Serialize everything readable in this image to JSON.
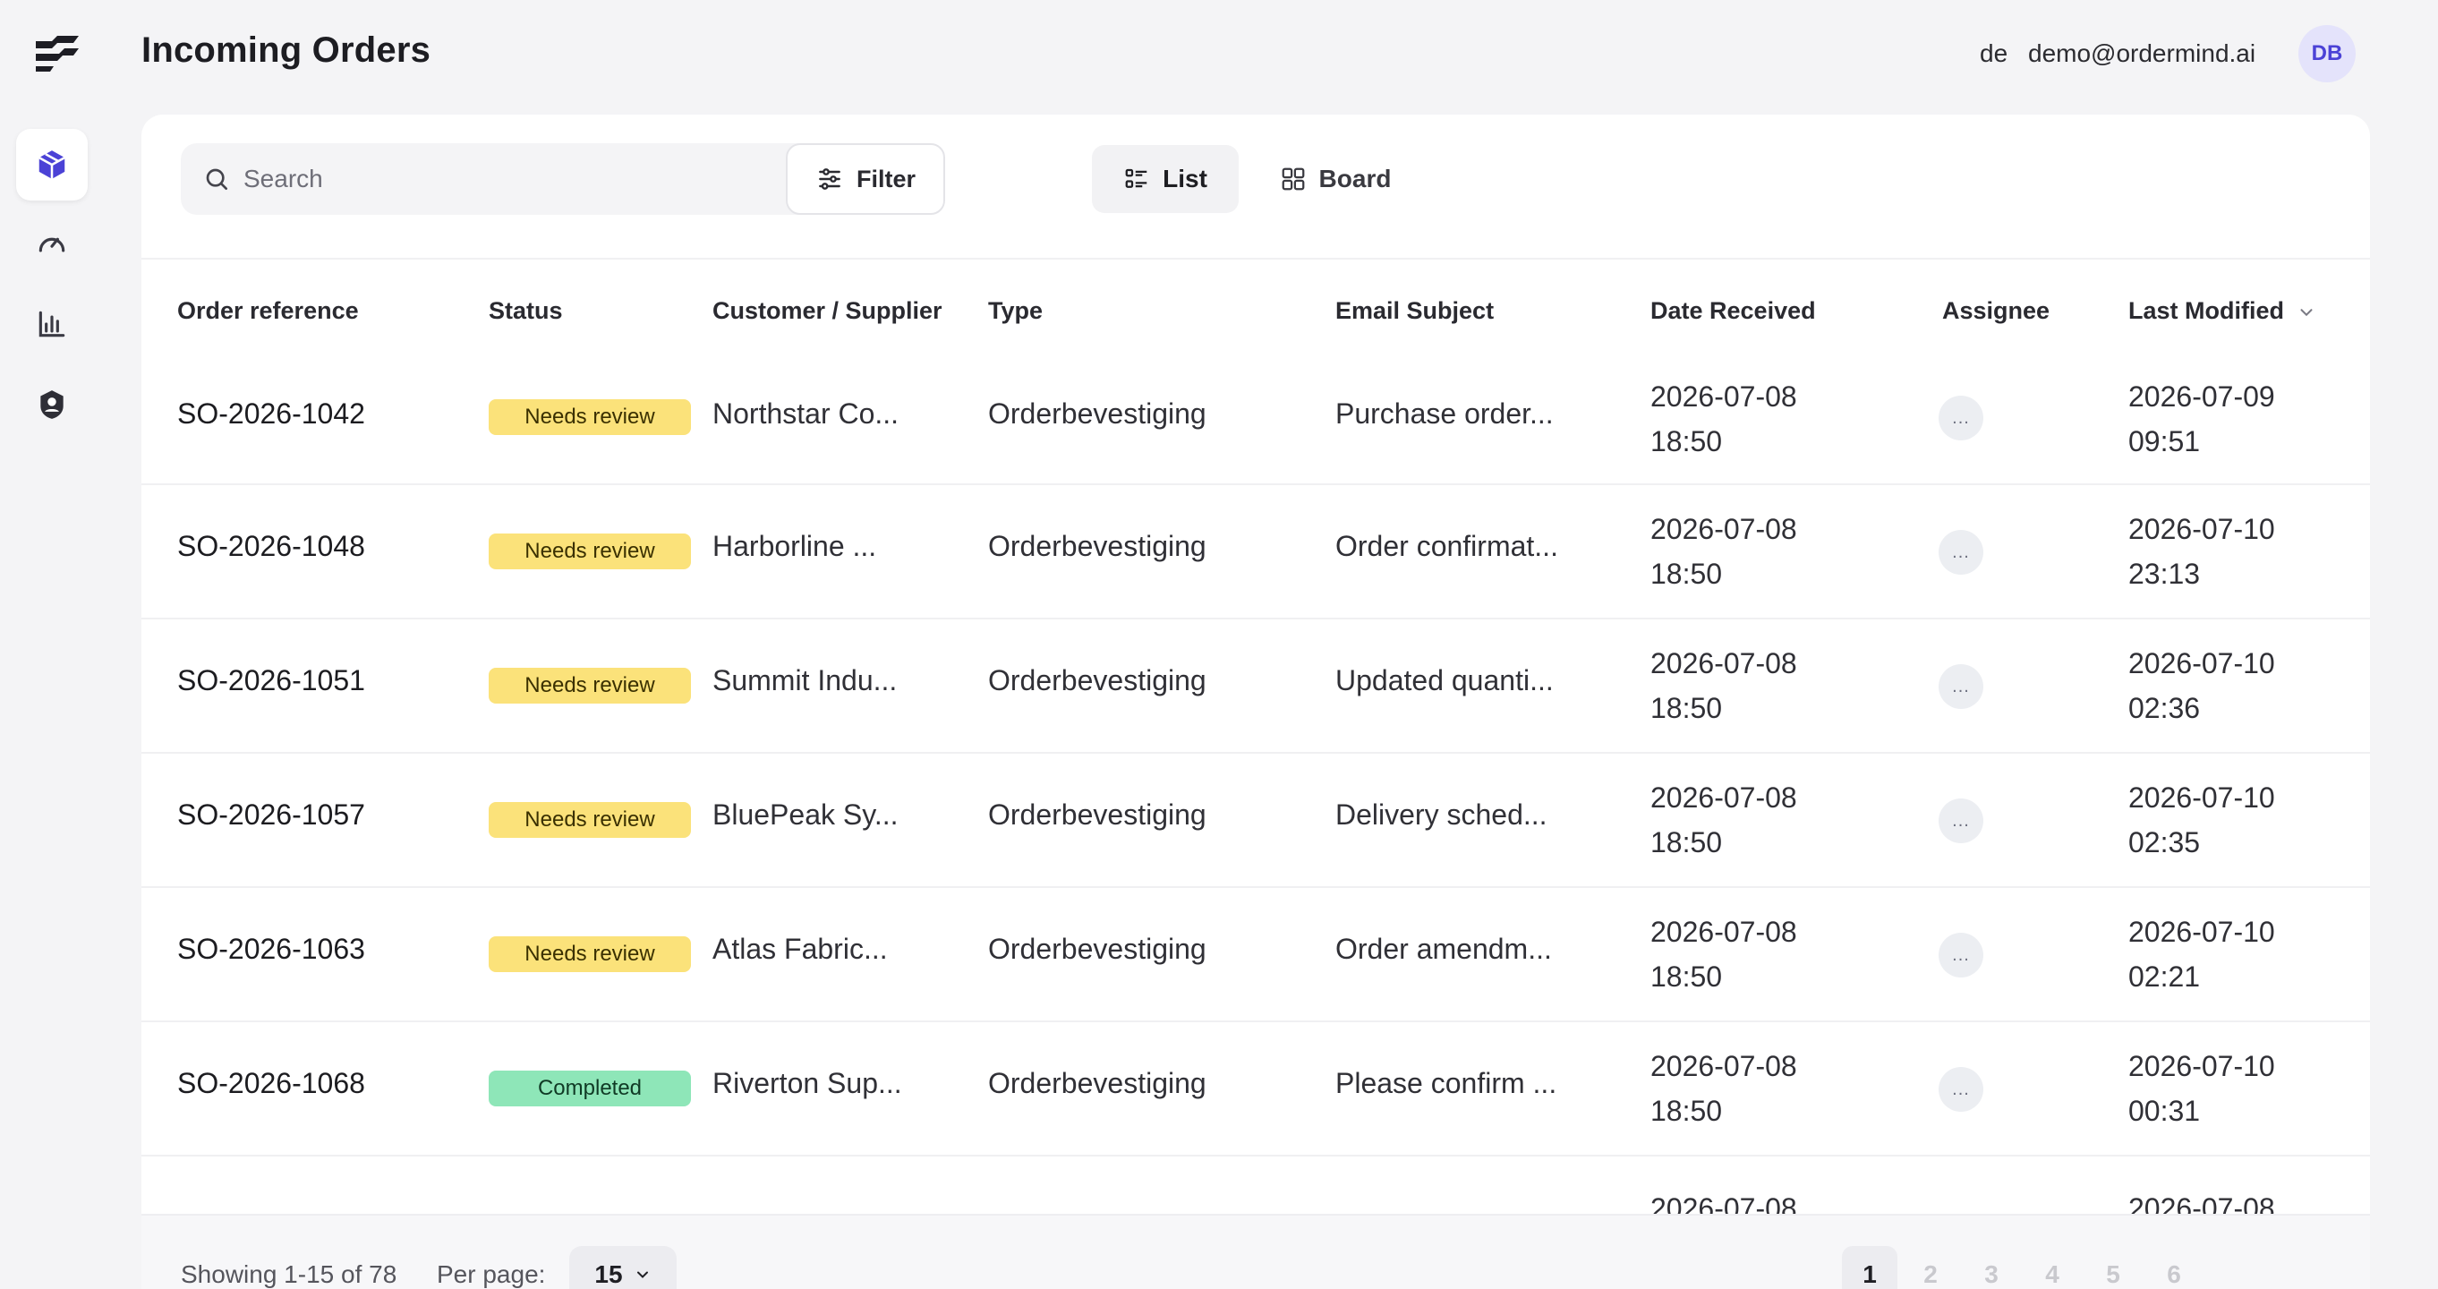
{
  "header": {
    "title": "Incoming Orders",
    "user_short": "de",
    "user_email": "demo@ordermind.ai",
    "avatar_initials": "DB"
  },
  "sidebar": {
    "items": [
      {
        "icon": "package-icon",
        "active": true
      },
      {
        "icon": "gauge-icon",
        "active": false
      },
      {
        "icon": "bar-chart-icon",
        "active": false
      },
      {
        "icon": "user-shield-icon",
        "active": false
      }
    ]
  },
  "toolbar": {
    "search_placeholder": "Search",
    "filter_label": "Filter",
    "view_list_label": "List",
    "view_board_label": "Board"
  },
  "table": {
    "columns": [
      "Order reference",
      "Status",
      "Customer / Supplier",
      "Type",
      "Email Subject",
      "Date Received",
      "Assignee",
      "Last Modified"
    ],
    "rows": [
      {
        "ref": "SO-2026-1042",
        "status": "Needs review",
        "status_kind": "review",
        "customer": "Northstar Co...",
        "type": "Orderbevestiging",
        "subject": "Purchase order...",
        "received_date": "2026-07-08",
        "received_time": "18:50",
        "assignee": "...",
        "modified_date": "2026-07-09",
        "modified_time": "09:51"
      },
      {
        "ref": "SO-2026-1048",
        "status": "Needs review",
        "status_kind": "review",
        "customer": "Harborline ...",
        "type": "Orderbevestiging",
        "subject": "Order confirmat...",
        "received_date": "2026-07-08",
        "received_time": "18:50",
        "assignee": "...",
        "modified_date": "2026-07-10",
        "modified_time": "23:13"
      },
      {
        "ref": "SO-2026-1051",
        "status": "Needs review",
        "status_kind": "review",
        "customer": "Summit Indu...",
        "type": "Orderbevestiging",
        "subject": "Updated quanti...",
        "received_date": "2026-07-08",
        "received_time": "18:50",
        "assignee": "...",
        "modified_date": "2026-07-10",
        "modified_time": "02:36"
      },
      {
        "ref": "SO-2026-1057",
        "status": "Needs review",
        "status_kind": "review",
        "customer": "BluePeak Sy...",
        "type": "Orderbevestiging",
        "subject": "Delivery sched...",
        "received_date": "2026-07-08",
        "received_time": "18:50",
        "assignee": "...",
        "modified_date": "2026-07-10",
        "modified_time": "02:35"
      },
      {
        "ref": "SO-2026-1063",
        "status": "Needs review",
        "status_kind": "review",
        "customer": "Atlas Fabric...",
        "type": "Orderbevestiging",
        "subject": "Order amendm...",
        "received_date": "2026-07-08",
        "received_time": "18:50",
        "assignee": "...",
        "modified_date": "2026-07-10",
        "modified_time": "02:21"
      },
      {
        "ref": "SO-2026-1068",
        "status": "Completed",
        "status_kind": "done",
        "customer": "Riverton Sup...",
        "type": "Orderbevestiging",
        "subject": "Please confirm ...",
        "received_date": "2026-07-08",
        "received_time": "18:50",
        "assignee": "...",
        "modified_date": "2026-07-10",
        "modified_time": "00:31"
      }
    ],
    "partial_row": {
      "received_date": "2026-07-08",
      "modified_date": "2026-07-08"
    }
  },
  "footer": {
    "showing": "Showing 1-15 of 78",
    "per_page_label": "Per page:",
    "per_page_value": "15",
    "pages": [
      "1",
      "2",
      "3",
      "4",
      "5",
      "6"
    ],
    "current_page": "1"
  },
  "colors": {
    "accent": "#4b42d6",
    "review_badge": "#fbe27a",
    "done_badge": "#8ee6b8"
  }
}
